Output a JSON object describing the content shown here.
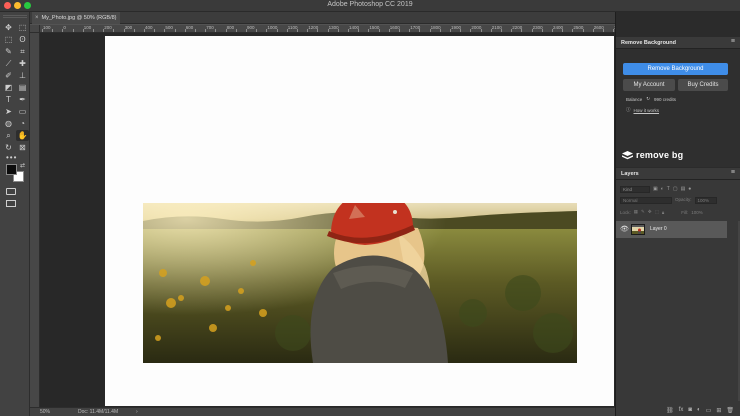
{
  "app": {
    "title": "Adobe Photoshop CC 2019"
  },
  "window": {
    "traffic_lights": [
      "#fc5f57",
      "#fdbc2e",
      "#28c840"
    ]
  },
  "document_tab": {
    "close_icon": "×",
    "name": "My_Photo.jpg @ 50% (RGB/8)"
  },
  "ruler": {
    "top_ticks": [
      "100",
      "50",
      "0",
      "50",
      "100",
      "150",
      "200",
      "250",
      "300",
      "350",
      "400",
      "450",
      "500",
      "550",
      "600",
      "650",
      "700",
      "750",
      "800",
      "850",
      "900",
      "950",
      "1000",
      "1050",
      "1100",
      "1150",
      "1200",
      "1250",
      "1300",
      "1350",
      "1400",
      "1450",
      "1500",
      "1550",
      "1600",
      "1650",
      "1700",
      "1750",
      "1800",
      "1850",
      "1900",
      "1950",
      "2000",
      "2050",
      "2100",
      "2150",
      "2200",
      "2250",
      "2300",
      "2350",
      "2400",
      "2450",
      "2500",
      "2550",
      "2600",
      "2650",
      "2700"
    ]
  },
  "toolbar": {
    "tools": [
      {
        "name": "move-tool",
        "glyph": "✥"
      },
      {
        "name": "artboard-tool",
        "glyph": "⬚"
      },
      {
        "name": "marquee-tool",
        "glyph": "⬚"
      },
      {
        "name": "lasso-tool",
        "glyph": "ʘ"
      },
      {
        "name": "quick-select-tool",
        "glyph": "✎"
      },
      {
        "name": "crop-tool",
        "glyph": "⌗"
      },
      {
        "name": "eyedropper-tool",
        "glyph": "⟋"
      },
      {
        "name": "healing-tool",
        "glyph": "✚"
      },
      {
        "name": "brush-tool",
        "glyph": "✐"
      },
      {
        "name": "stamp-tool",
        "glyph": "⊥"
      },
      {
        "name": "eraser-tool",
        "glyph": "◩"
      },
      {
        "name": "gradient-tool",
        "glyph": "▤"
      },
      {
        "name": "type-tool",
        "glyph": "T"
      },
      {
        "name": "pen-tool",
        "glyph": "✒"
      },
      {
        "name": "path-select-tool",
        "glyph": "➤"
      },
      {
        "name": "rectangle-tool",
        "glyph": "▭"
      },
      {
        "name": "blur-tool",
        "glyph": "◍"
      },
      {
        "name": "dodge-tool",
        "glyph": "◔"
      },
      {
        "name": "zoom-tool",
        "glyph": "⌕"
      },
      {
        "name": "hand-tool",
        "glyph": "✋"
      },
      {
        "name": "rotate-view-tool",
        "glyph": "↻"
      },
      {
        "name": "frame-tool",
        "glyph": "⊠"
      }
    ],
    "active_tool": "hand-tool",
    "more_label": "•••",
    "foreground_color": "#0c0c0c",
    "background_color": "#ffffff"
  },
  "remove_bg": {
    "panel_title": "Remove Background",
    "remove_button": "Remove Background",
    "my_account_button": "My Account",
    "buy_credits_button": "Buy Credits",
    "balance_label": "Balance",
    "balance_value": "990 credits",
    "how_it_works": "How it works",
    "logo_text": "remove bg",
    "accent": "#3f8de8"
  },
  "layers": {
    "panel_title": "Layers",
    "kind_placeholder": "Kind",
    "blend_mode": "Normal",
    "opacity_label": "Opacity:",
    "opacity_value": "100%",
    "lock_label": "Lock:",
    "fill_label": "Fill:",
    "fill_value": "100%",
    "items": [
      {
        "name": "Layer 0",
        "visible": true
      }
    ]
  },
  "status": {
    "zoom": "50%",
    "doc_info": "Doc: 11.4M/11.4M",
    "arrow": "›"
  }
}
